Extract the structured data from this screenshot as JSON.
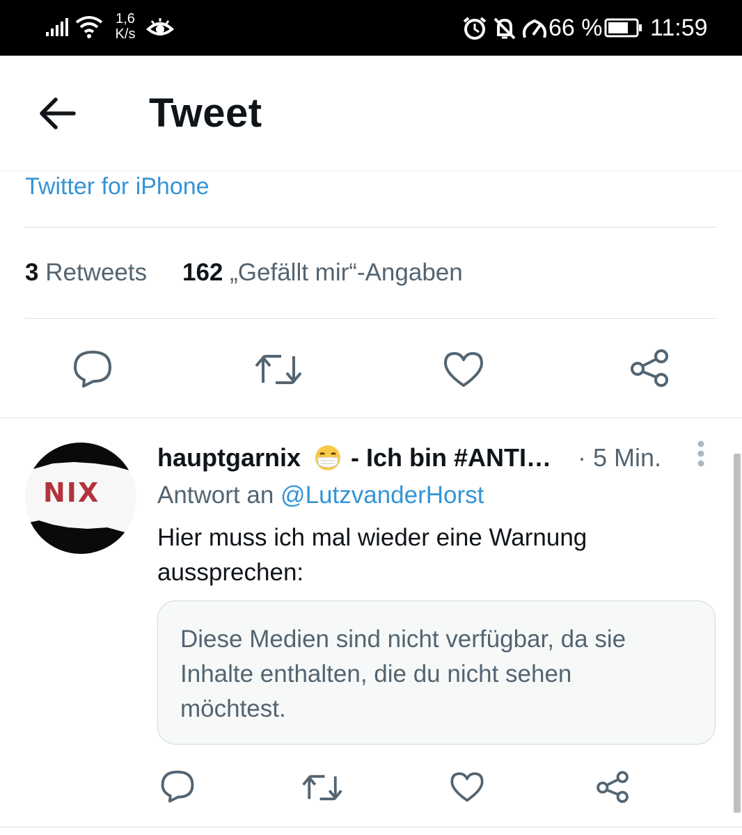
{
  "status_bar": {
    "network_speed_value": "1,6",
    "network_speed_unit": "K/s",
    "battery": "66 %",
    "time": "11:59",
    "icons": [
      "signal-icon",
      "wifi-icon",
      "eye-icon",
      "alarm-icon",
      "bell-off-icon",
      "gauge-icon",
      "battery-icon"
    ]
  },
  "header": {
    "title": "Tweet",
    "back_icon": "arrow-left-icon"
  },
  "tweet": {
    "source": "Twitter for iPhone",
    "retweets_count": "3",
    "retweets_label": "Retweets",
    "likes_count": "162",
    "likes_label": "„Gefällt mir“-Angaben",
    "actions": [
      "reply-icon",
      "retweet-icon",
      "like-icon",
      "share-icon"
    ]
  },
  "reply": {
    "avatar_text": "NIX",
    "display_name": "hauptgarnix",
    "display_name_suffix": " - Ich bin #ANTI…",
    "time": "· 5 Min.",
    "reply_to_label": "Antwort an ",
    "reply_to_handle": "@LutzvanderHorst",
    "text": "Hier muss ich mal wieder eine Warnung aussprechen:",
    "media_notice": "Diese Medien sind nicht verfügbar, da sie Inhalte enthalten, die du nicht sehen möchtest.",
    "actions": [
      "reply-icon",
      "retweet-icon",
      "like-icon",
      "share-icon"
    ]
  },
  "colors": {
    "link": "#3494d6",
    "secondary_text": "#536471",
    "primary_text": "#0f1419",
    "divider": "#d5e0e8"
  }
}
